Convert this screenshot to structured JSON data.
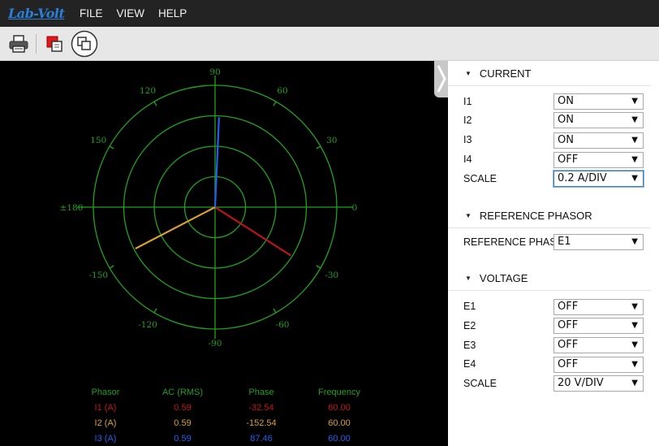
{
  "app": {
    "logo_text": "Lab-Volt"
  },
  "menu": [
    "FILE",
    "VIEW",
    "HELP"
  ],
  "toolbar": {
    "buttons": [
      {
        "icon": "printer-icon"
      },
      {
        "icon": "copy-image-icon"
      },
      {
        "icon": "freeze-icon"
      }
    ]
  },
  "scope": {
    "angle_labels": [
      "90",
      "60",
      "30",
      "0",
      "-30",
      "-60",
      "-90",
      "-120",
      "-150",
      "±180",
      "150",
      "120"
    ],
    "phasors": [
      {
        "name": "I1 (A)",
        "rms": 0.59,
        "phase_deg": -32.54,
        "color": "#c0141b"
      },
      {
        "name": "I2 (A)",
        "rms": 0.59,
        "phase_deg": -152.54,
        "color": "#d8a02e"
      },
      {
        "name": "I3 (A)",
        "rms": 0.59,
        "phase_deg": 87.46,
        "color": "#2060ee"
      }
    ],
    "scale_a_per_div": 0.2,
    "grid_color": "#1fa31f",
    "table": {
      "headers": [
        "Phasor",
        "AC (RMS)",
        "Phase",
        "Frequency"
      ],
      "rows": [
        {
          "phasor": "I1 (A)",
          "rms": "0.59",
          "phase": "-32.54",
          "freq": "60.00",
          "color": "#c0141b"
        },
        {
          "phasor": "I2 (A)",
          "rms": "0.59",
          "phase": "-152.54",
          "freq": "60.00",
          "color": "#d8a02e"
        },
        {
          "phasor": "I3 (A)",
          "rms": "0.59",
          "phase": "87.46",
          "freq": "60.00",
          "color": "#2060ee"
        }
      ],
      "header_color": "#1f9e1f"
    }
  },
  "panel": {
    "current": {
      "title": "CURRENT",
      "rows": [
        {
          "label": "I1",
          "value": "ON"
        },
        {
          "label": "I2",
          "value": "ON"
        },
        {
          "label": "I3",
          "value": "ON"
        },
        {
          "label": "I4",
          "value": "OFF"
        },
        {
          "label": "SCALE",
          "value": "0.2 A/DIV"
        }
      ]
    },
    "reference": {
      "title": "REFERENCE PHASOR",
      "rows": [
        {
          "label": "REFERENCE PHASOR",
          "value": "E1"
        }
      ]
    },
    "voltage": {
      "title": "VOLTAGE",
      "rows": [
        {
          "label": "E1",
          "value": "OFF"
        },
        {
          "label": "E2",
          "value": "OFF"
        },
        {
          "label": "E3",
          "value": "OFF"
        },
        {
          "label": "E4",
          "value": "OFF"
        },
        {
          "label": "SCALE",
          "value": "20 V/DIV"
        }
      ]
    }
  }
}
